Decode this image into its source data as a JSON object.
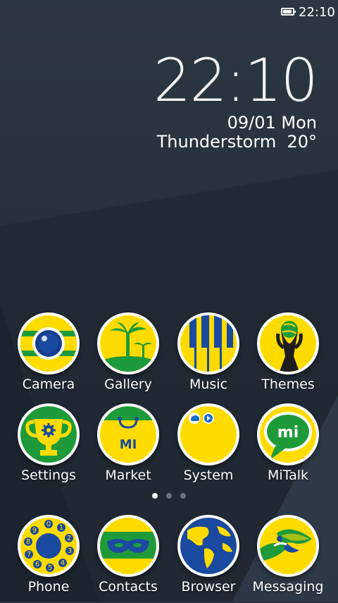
{
  "status_bar": {
    "time": "22:10",
    "battery_icon": "battery-icon"
  },
  "clock": {
    "time": "22:10",
    "date": "09/01 Mon",
    "weather": "Thunderstorm  20°"
  },
  "apps": [
    {
      "label": "Camera",
      "icon": "camera-icon"
    },
    {
      "label": "Gallery",
      "icon": "palm-tree-icon"
    },
    {
      "label": "Music",
      "icon": "piano-keys-icon"
    },
    {
      "label": "Themes",
      "icon": "trophy-cup-icon"
    },
    {
      "label": "Settings",
      "icon": "gear-cup-icon"
    },
    {
      "label": "Market",
      "icon": "shopping-bag-icon"
    },
    {
      "label": "System",
      "icon": "cloud-play-icon"
    },
    {
      "label": "MiTalk",
      "icon": "chat-bubble-icon"
    }
  ],
  "page_indicator": {
    "pages": 3,
    "current": 1
  },
  "dock": [
    {
      "label": "Phone",
      "icon": "rotary-dial-icon"
    },
    {
      "label": "Contacts",
      "icon": "mask-icon"
    },
    {
      "label": "Browser",
      "icon": "globe-icon"
    },
    {
      "label": "Messaging",
      "icon": "toucan-icon"
    }
  ],
  "colors": {
    "yellow": "#ffdb00",
    "green": "#1f9a3a",
    "blue": "#1a4aa0",
    "white": "#ffffff",
    "background": "#26303c"
  }
}
